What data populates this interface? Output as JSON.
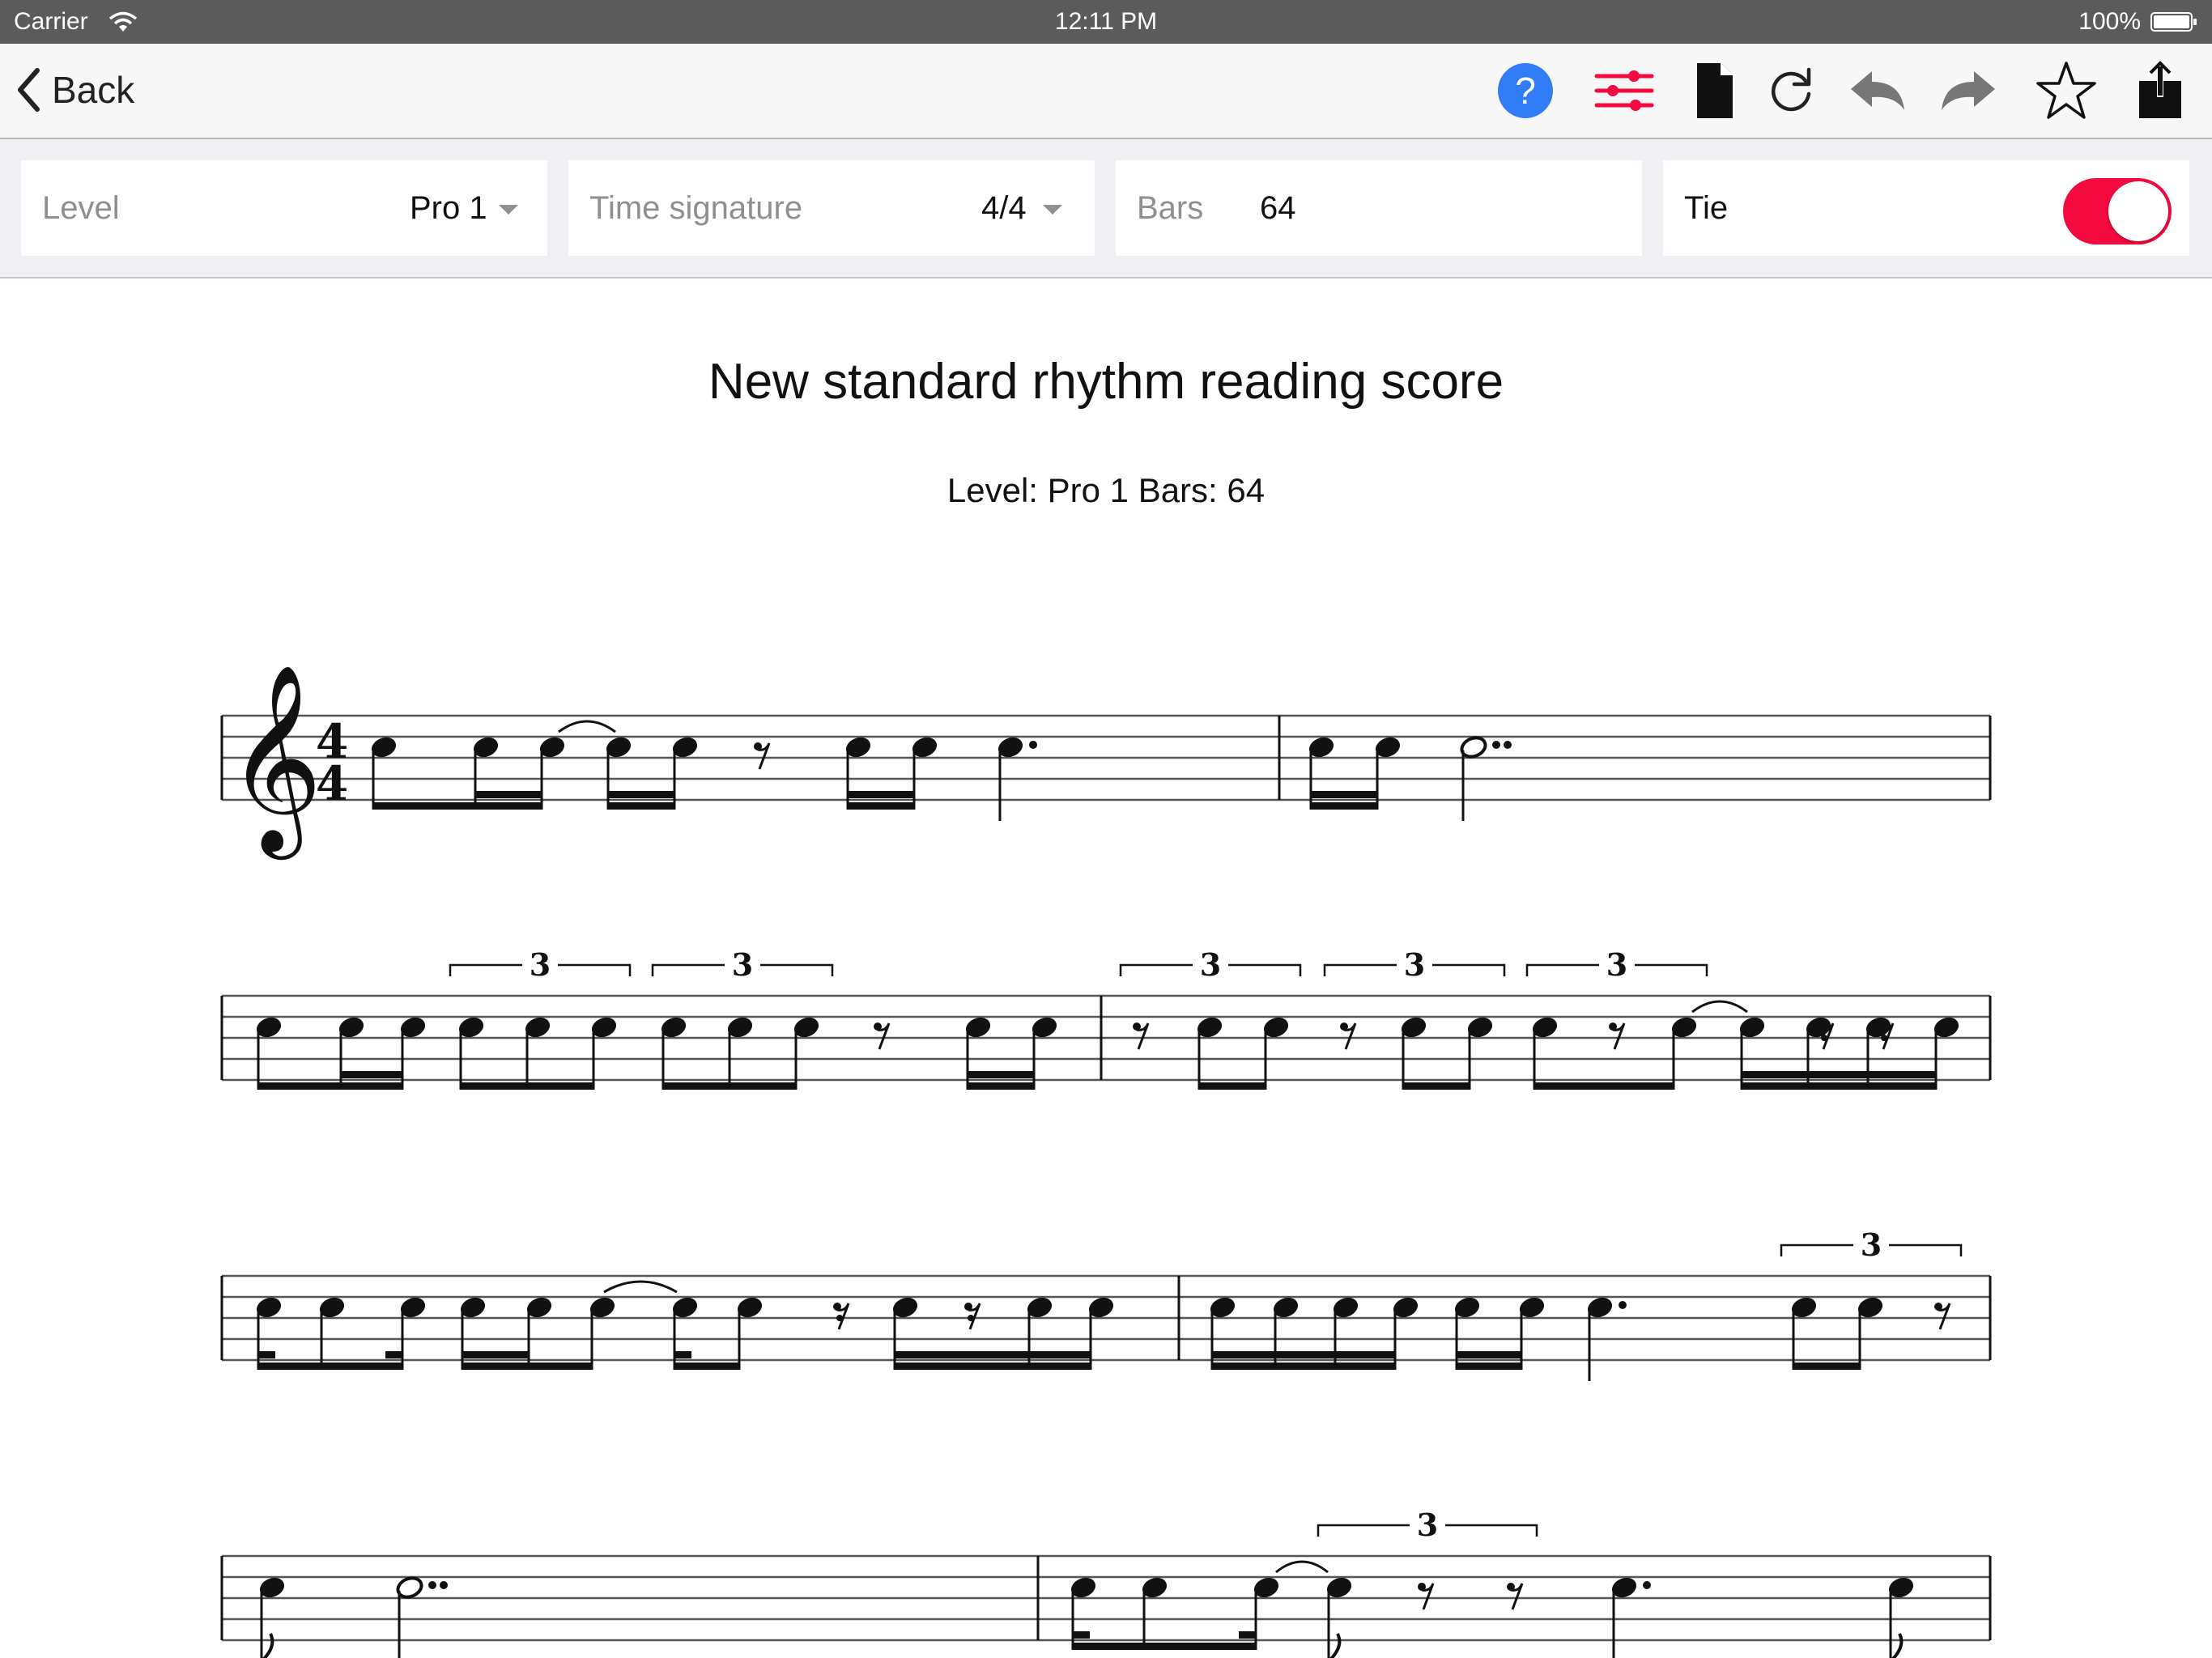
{
  "status_bar": {
    "carrier": "Carrier",
    "time": "12:11 PM",
    "battery": "100%"
  },
  "nav_bar": {
    "back_label": "Back",
    "icons": [
      "help-icon",
      "sliders-icon",
      "document-icon",
      "refresh-icon",
      "undo-icon",
      "redo-icon",
      "star-icon",
      "share-icon"
    ],
    "help_glyph": "?",
    "accent_color": "#f40a3e",
    "help_color": "#2f7cf6"
  },
  "toolbar": {
    "level": {
      "label": "Level",
      "value": "Pro 1"
    },
    "time_signature": {
      "label": "Time signature",
      "value": "4/4"
    },
    "bars": {
      "label": "Bars",
      "value": "64"
    },
    "tie": {
      "label": "Tie",
      "on": true
    }
  },
  "score": {
    "title": "New standard rhythm reading score",
    "subtitle": "Level: Pro 1 Bars: 64",
    "clef": "treble",
    "time_signature_top": "4",
    "time_signature_bottom": "4",
    "tuplet_label": "3",
    "systems_visible": 4
  }
}
